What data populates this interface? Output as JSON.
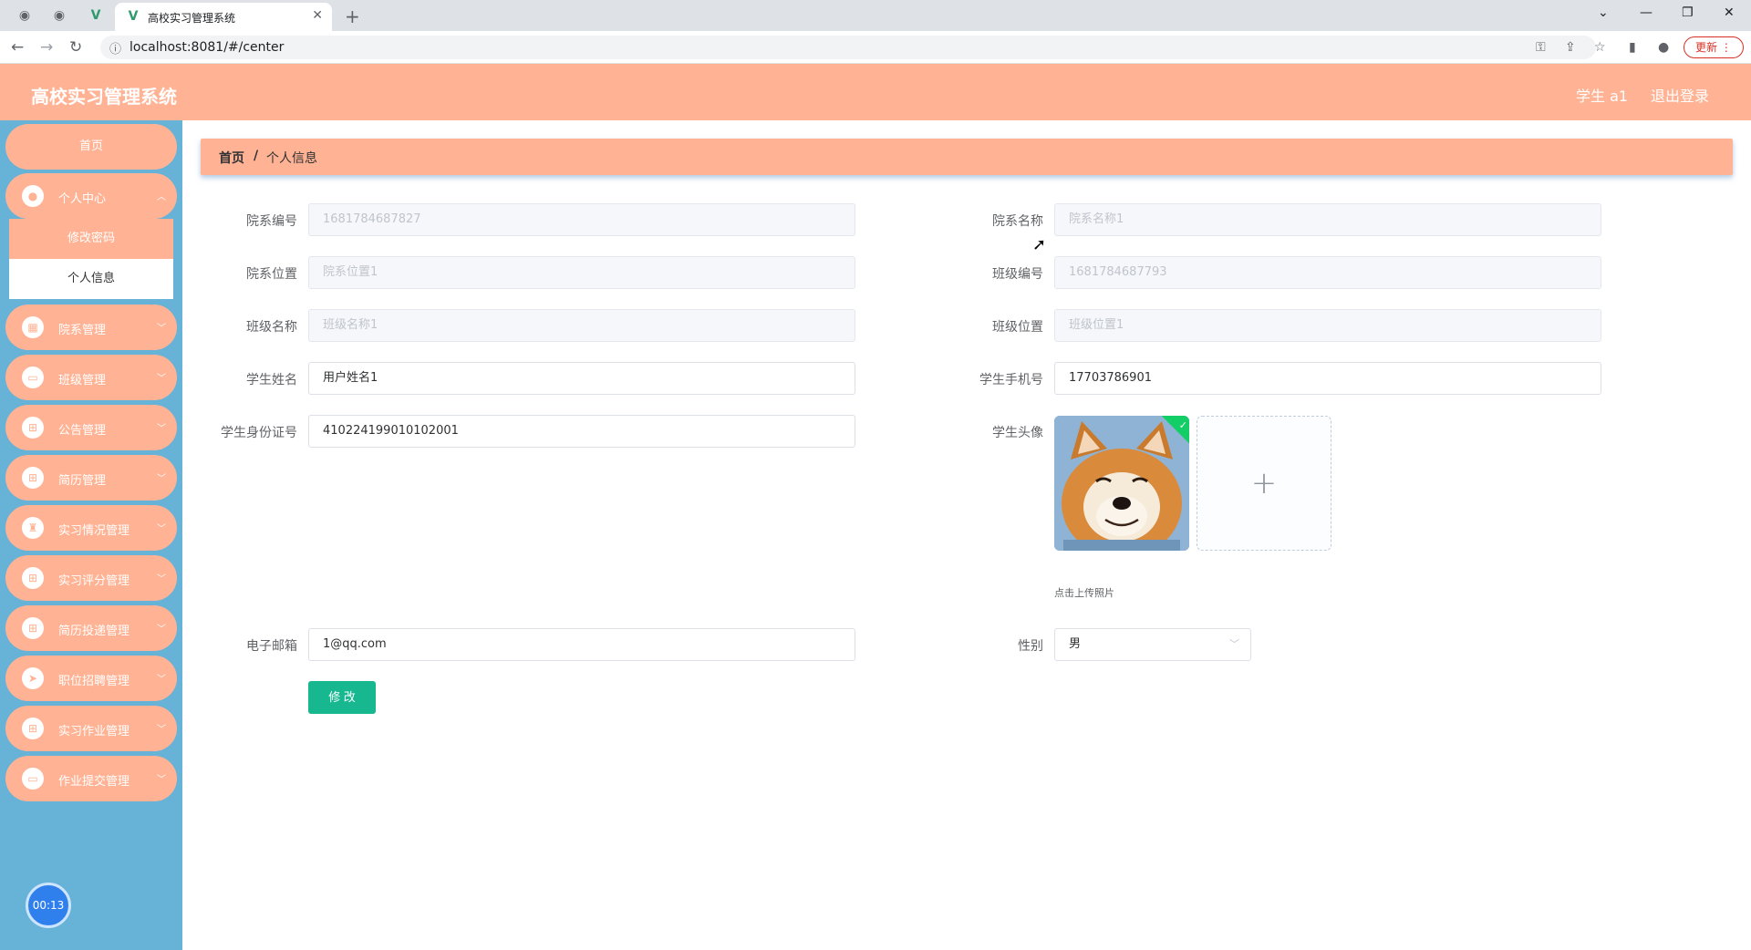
{
  "browser": {
    "tab_title": "高校实习管理系统",
    "url": "localhost:8081/#/center",
    "update_label": "更新"
  },
  "header": {
    "title": "高校实习管理系统",
    "user": "学生 a1",
    "logout": "退出登录"
  },
  "sidebar": {
    "home": "首页",
    "center": "个人中心",
    "center_sub": [
      "修改密码",
      "个人信息"
    ],
    "items": [
      "院系管理",
      "班级管理",
      "公告管理",
      "简历管理",
      "实习情况管理",
      "实习评分管理",
      "简历投递管理",
      "职位招聘管理",
      "实习作业管理",
      "作业提交管理"
    ],
    "timer": "00:13"
  },
  "breadcrumb": {
    "home": "首页",
    "sep": "/",
    "current": "个人信息"
  },
  "form": {
    "dept_no_label": "院系编号",
    "dept_no": "1681784687827",
    "dept_name_label": "院系名称",
    "dept_name": "院系名称1",
    "dept_loc_label": "院系位置",
    "dept_loc": "院系位置1",
    "class_no_label": "班级编号",
    "class_no": "1681784687793",
    "class_name_label": "班级名称",
    "class_name": "班级名称1",
    "class_loc_label": "班级位置",
    "class_loc": "班级位置1",
    "student_name_label": "学生姓名",
    "student_name": "用户姓名1",
    "phone_label": "学生手机号",
    "phone": "17703786901",
    "id_card_label": "学生身份证号",
    "id_card": "410224199010102001",
    "avatar_label": "学生头像",
    "upload_tip": "点击上传照片",
    "email_label": "电子邮箱",
    "email": "1@qq.com",
    "gender_label": "性别",
    "gender": "男",
    "submit": "修 改"
  }
}
